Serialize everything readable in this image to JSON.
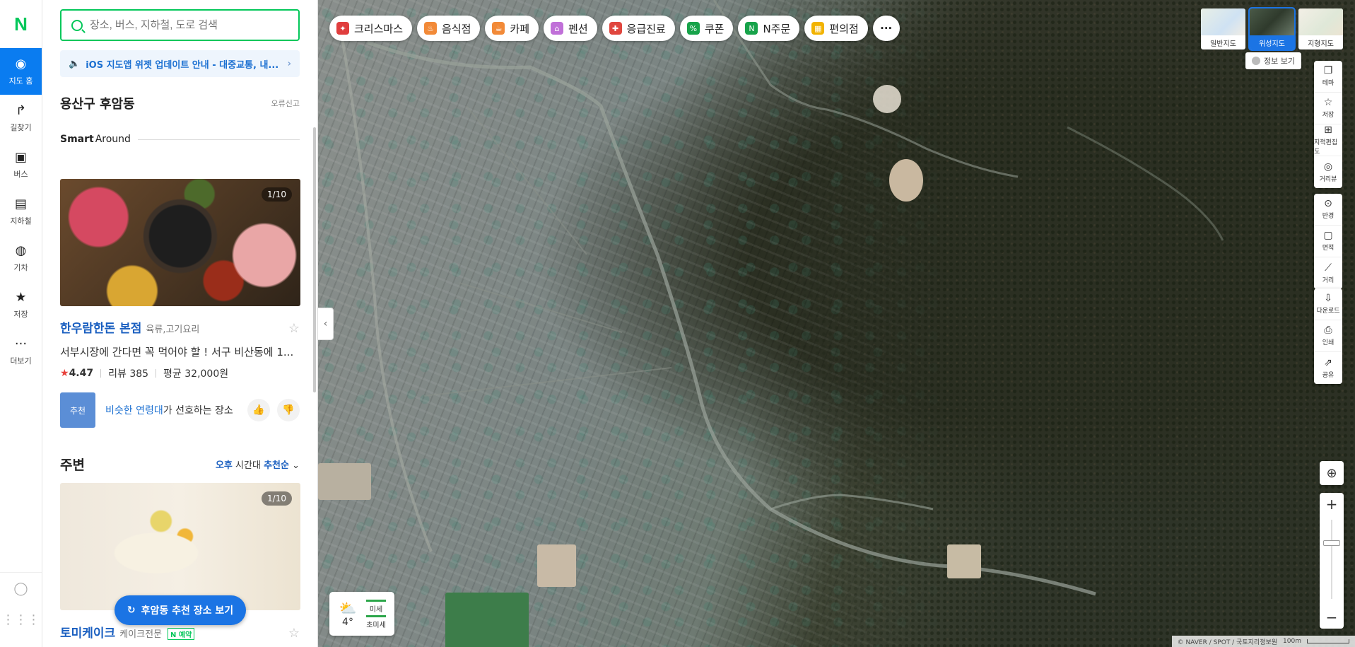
{
  "nav": {
    "logo": "N",
    "items": [
      {
        "label": "지도 홈",
        "icon": "map-pin-icon",
        "glyph": "◉"
      },
      {
        "label": "길찾기",
        "icon": "directions-icon",
        "glyph": "↱"
      },
      {
        "label": "버스",
        "icon": "bus-icon",
        "glyph": "▣"
      },
      {
        "label": "지하철",
        "icon": "subway-icon",
        "glyph": "▤"
      },
      {
        "label": "기차",
        "icon": "train-icon",
        "glyph": "◍"
      },
      {
        "label": "저장",
        "icon": "star-icon",
        "glyph": "★"
      },
      {
        "label": "더보기",
        "icon": "more-icon",
        "glyph": "···"
      }
    ]
  },
  "search": {
    "placeholder": "장소, 버스, 지하철, 도로 검색"
  },
  "notice": {
    "text": "iOS 지도앱 위젯 업데이트 안내 - 대중교통, 내..."
  },
  "location": {
    "name": "용산구 후암동",
    "report": "오류신고"
  },
  "smart_around": {
    "bold": "Smart",
    "rest": "Around"
  },
  "place1": {
    "counter": "1/10",
    "name": "한우람한돈 본점",
    "category": "육류,고기요리",
    "description": "서부시장에 간다면 꼭 먹어야 할 ! 서구 비산동에 1...",
    "rating": "4.47",
    "reviews": "리뷰 385",
    "avg_price": "평균 32,000원"
  },
  "recommend": {
    "tag": "추천",
    "highlight": "비슷한 연령대",
    "text": "가 선호하는 장소"
  },
  "nearby": {
    "title": "주변",
    "time": "오후",
    "time_suffix": "시간대",
    "sort": "추천순"
  },
  "place2": {
    "counter": "1/10",
    "name": "토미케이크",
    "category": "케이크전문",
    "booking": "예약"
  },
  "float_button": {
    "label": "후암동 추천 장소 보기"
  },
  "chips": [
    {
      "label": "크리스마스",
      "color": "#e03e3e",
      "glyph": "✦"
    },
    {
      "label": "음식점",
      "color": "#f28a38",
      "glyph": "♨"
    },
    {
      "label": "카페",
      "color": "#f28a38",
      "glyph": "☕"
    },
    {
      "label": "펜션",
      "color": "#c070d8",
      "glyph": "⌂"
    },
    {
      "label": "응급진료",
      "color": "#e0463e",
      "glyph": "✚"
    },
    {
      "label": "쿠폰",
      "color": "#17a34a",
      "glyph": "%"
    },
    {
      "label": "N주문",
      "color": "#17a34a",
      "glyph": "N"
    },
    {
      "label": "편의점",
      "color": "#f2b300",
      "glyph": "▦"
    }
  ],
  "map_types": [
    {
      "label": "일반지도",
      "selected": false
    },
    {
      "label": "위성지도",
      "selected": true
    },
    {
      "label": "지형지도",
      "selected": false
    }
  ],
  "info_toggle": "정보 보기",
  "tools_group1": [
    {
      "label": "테마",
      "icon": "theme-icon",
      "glyph": "❐"
    },
    {
      "label": "저장",
      "icon": "save-star-icon",
      "glyph": "☆"
    },
    {
      "label": "지적편집도",
      "icon": "cadastral-icon",
      "glyph": "⊞"
    },
    {
      "label": "거리뷰",
      "icon": "street-view-icon",
      "glyph": "◎"
    }
  ],
  "tools_group2": [
    {
      "label": "반경",
      "icon": "radius-icon",
      "glyph": "⊙"
    },
    {
      "label": "면적",
      "icon": "area-icon",
      "glyph": "▢"
    },
    {
      "label": "거리",
      "icon": "ruler-icon",
      "glyph": "⟋"
    }
  ],
  "tools_group3": [
    {
      "label": "다운로드",
      "icon": "download-icon",
      "glyph": "⇩"
    },
    {
      "label": "인쇄",
      "icon": "print-icon",
      "glyph": "⎙"
    },
    {
      "label": "공유",
      "icon": "share-icon",
      "glyph": "⇗"
    }
  ],
  "weather": {
    "temp": "4°",
    "label1": "미세",
    "label2": "초미세"
  },
  "copyright": {
    "text": "© NAVER / SPOT / 국토지리정보원",
    "scale": "100m"
  }
}
